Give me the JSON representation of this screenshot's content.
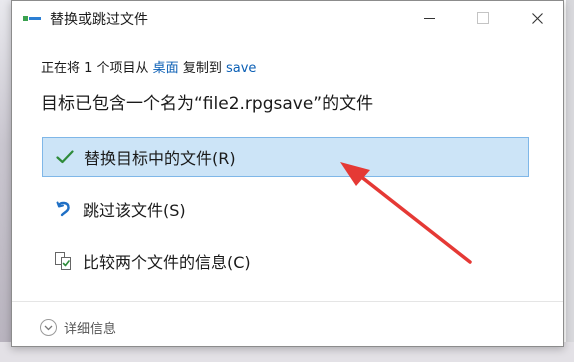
{
  "window": {
    "title": "替换或跳过文件",
    "controls": [
      "minimize-icon",
      "maximize-icon",
      "close-icon"
    ]
  },
  "info": {
    "prefix": "正在将 1 个项目从 ",
    "source": "桌面",
    "middle": " 复制到 ",
    "destination": "save"
  },
  "heading": "目标已包含一个名为“file2.rpgsave”的文件",
  "options": [
    {
      "label": "替换目标中的文件(R)",
      "icon": "checkmark-icon",
      "selected": true
    },
    {
      "label": "跳过该文件(S)",
      "icon": "skip-arrow-icon",
      "selected": false
    },
    {
      "label": "比较两个文件的信息(C)",
      "icon": "compare-files-icon",
      "selected": false
    }
  ],
  "footer": {
    "details_label": "详细信息",
    "details_icon": "chevron-down-icon"
  },
  "colors": {
    "link": "#0b5fb5",
    "selection_bg": "#cce4f7",
    "selection_border": "#7fb7e8",
    "annotation_arrow": "#e53935",
    "checkmark": "#2e8b3a"
  },
  "annotation": {
    "type": "red-arrow",
    "points_to": "替换目标中的文件(R)"
  }
}
